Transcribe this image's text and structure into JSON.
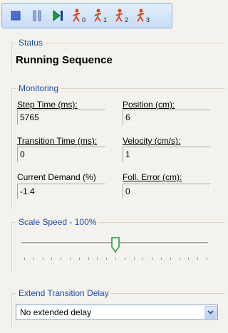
{
  "toolbar": {
    "buttons": [
      {
        "name": "stop-button",
        "icon": "stop-icon"
      },
      {
        "name": "pause-button",
        "icon": "pause-icon"
      },
      {
        "name": "step-forward-button",
        "icon": "step-forward-icon"
      },
      {
        "name": "seq0-button",
        "icon": "runner-icon",
        "subscript": "0"
      },
      {
        "name": "seq1-button",
        "icon": "runner-icon",
        "subscript": "1"
      },
      {
        "name": "seq2-button",
        "icon": "runner-icon",
        "subscript": "2"
      },
      {
        "name": "seq3-button",
        "icon": "runner-icon",
        "subscript": "3"
      }
    ]
  },
  "status": {
    "title": "Status",
    "value": "Running Sequence"
  },
  "monitoring": {
    "title": "Monitoring",
    "step_time_label": "Step Time (ms):",
    "step_time_value": "5765",
    "position_label": "Position  (cm):",
    "position_value": "6",
    "transition_time_label": "Transition Time (ms):",
    "transition_time_value": "0",
    "velocity_label": "Velocity  (cm/s):",
    "velocity_value": "1",
    "current_demand_label": "Current Demand (%)",
    "current_demand_value": "-1.4",
    "foll_error_label": "Foll. Error  (cm):",
    "foll_error_value": "0"
  },
  "scale_speed": {
    "title": "Scale Speed - 100%",
    "value_percent": 100,
    "slider_fraction": 0.5
  },
  "extend_delay": {
    "title": "Extend Transition Delay",
    "selected": "No extended delay"
  },
  "colors": {
    "group_title": "#1f4eaa",
    "stop_icon": "#4f6fd0",
    "play_icon": "#1a9a3a",
    "runner_icon": "#d84a1a"
  }
}
